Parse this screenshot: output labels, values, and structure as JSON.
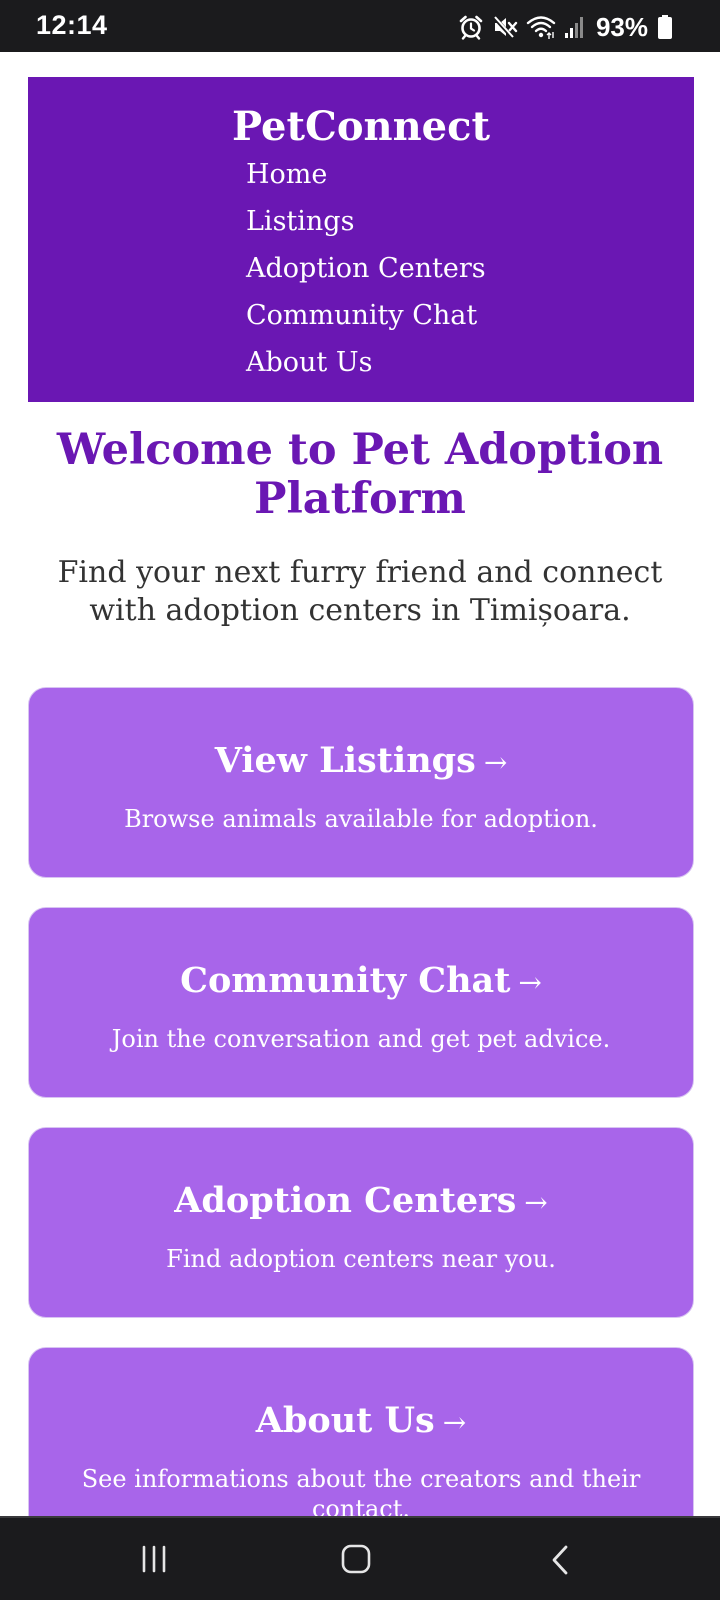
{
  "status": {
    "time": "12:14",
    "battery": "93%",
    "icons": [
      "alarm-icon",
      "mute-icon",
      "wifi-icon",
      "signal-icon",
      "battery-icon"
    ]
  },
  "header": {
    "brand": "PetConnect",
    "nav": [
      "Home",
      "Listings",
      "Adoption Centers",
      "Community Chat",
      "About Us"
    ]
  },
  "main": {
    "welcome": "Welcome to Pet Adoption Platform",
    "tagline": "Find your next furry friend and connect with adoption centers in Timișoara."
  },
  "cards": [
    {
      "title": "View Listings",
      "arrow": "→",
      "desc": "Browse animals available for adoption."
    },
    {
      "title": "Community Chat",
      "arrow": "→",
      "desc": "Join the conversation and get pet advice."
    },
    {
      "title": "Adoption Centers",
      "arrow": "→",
      "desc": "Find adoption centers near you."
    },
    {
      "title": "About Us",
      "arrow": "→",
      "desc": "See informations about the creators and their contact."
    }
  ],
  "system_nav": [
    "recents-icon",
    "home-icon",
    "back-icon"
  ],
  "colors": {
    "header_bg": "#6a17b3",
    "card_bg": "#a865ea",
    "heading": "#6a17b3",
    "system_bar": "#1b1b1d"
  }
}
